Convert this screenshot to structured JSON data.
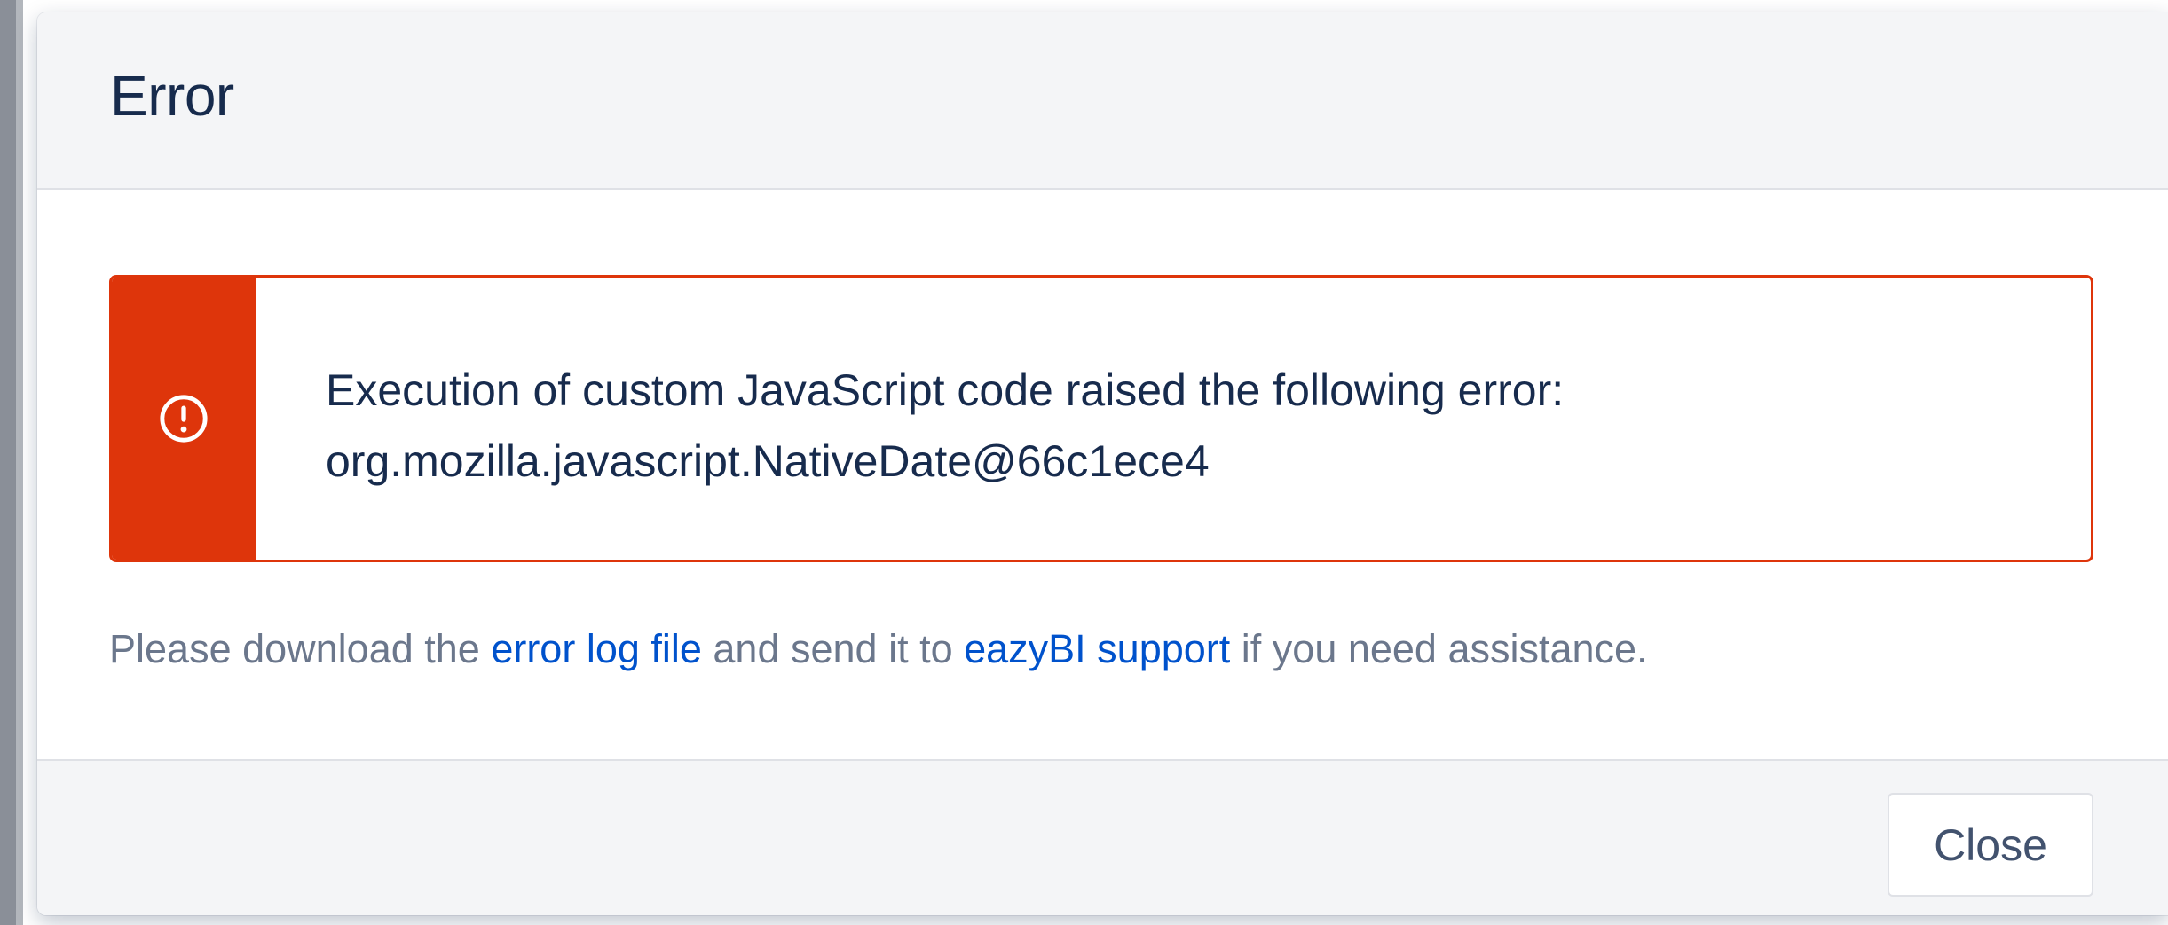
{
  "dialog": {
    "title": "Error"
  },
  "error": {
    "icon": "exclamation-circle-icon",
    "message_line1": "Execution of custom JavaScript code raised the following error:",
    "message_line2": "org.mozilla.javascript.NativeDate@66c1ece4"
  },
  "help": {
    "prefix": "Please download the ",
    "log_link": "error log file",
    "middle": " and send it to ",
    "support_link": "eazyBI support",
    "suffix": " if you need assistance."
  },
  "footer": {
    "close_label": "Close"
  },
  "colors": {
    "error_accent": "#de350b",
    "title_text": "#172b4d",
    "link": "#0052cc",
    "muted_text": "#6b778c",
    "header_bg": "#f4f5f7"
  }
}
